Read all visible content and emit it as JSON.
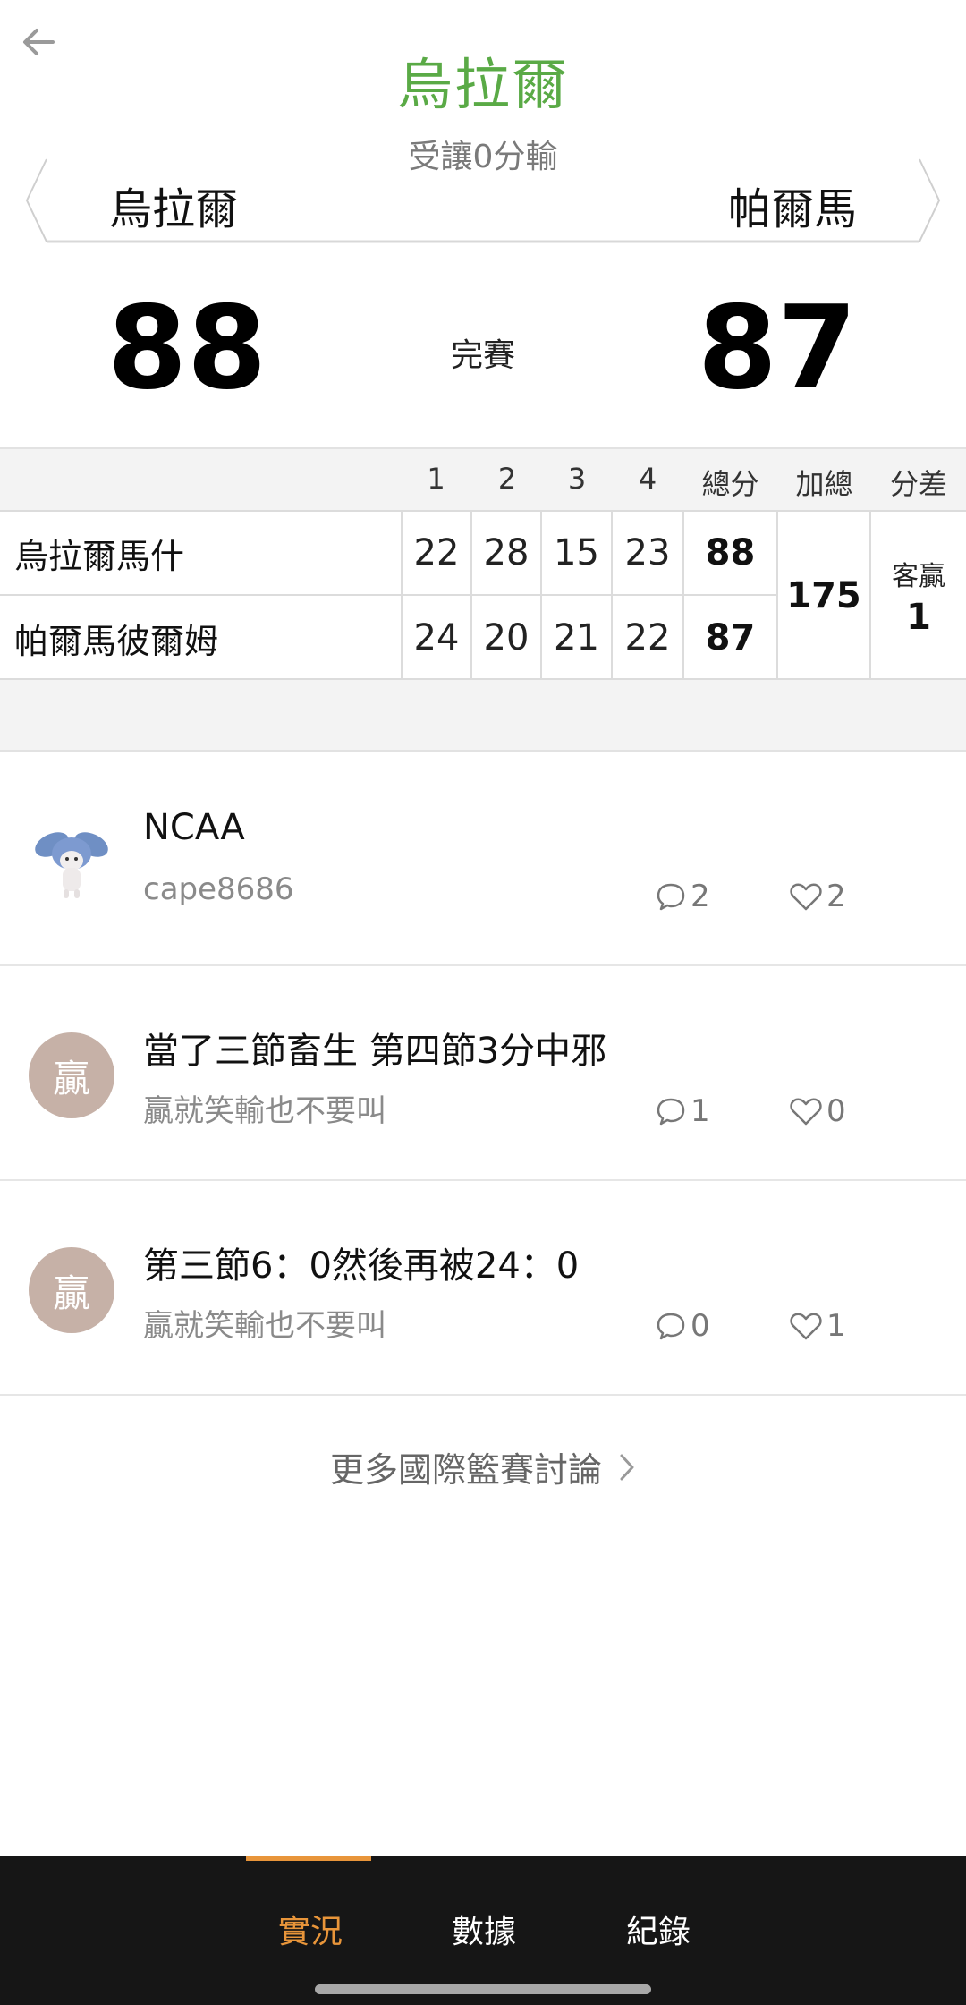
{
  "header": {
    "title": "烏拉爾",
    "handicap": "受讓0分輸",
    "home_team": "烏拉爾",
    "away_team": "帕爾馬",
    "home_score": "88",
    "away_score": "87",
    "status": "完賽"
  },
  "score_table": {
    "headers": [
      "1",
      "2",
      "3",
      "4",
      "總分",
      "加總",
      "分差"
    ],
    "rows": [
      {
        "team": "烏拉爾馬什",
        "q1": "22",
        "q2": "28",
        "q3": "15",
        "q4": "23",
        "total": "88"
      },
      {
        "team": "帕爾馬彼爾姆",
        "q1": "24",
        "q2": "20",
        "q3": "21",
        "q4": "22",
        "total": "87"
      }
    ],
    "combined_total": "175",
    "spread_label": "客贏",
    "spread_value": "1"
  },
  "posts": [
    {
      "title": "NCAA",
      "author": "cape8686",
      "avatar_type": "image",
      "avatar_text": "",
      "comments": "2",
      "likes": "2"
    },
    {
      "title": "當了三節畜生 第四節3分中邪",
      "author": "贏就笑輸也不要叫",
      "avatar_type": "text",
      "avatar_text": "贏",
      "comments": "1",
      "likes": "0"
    },
    {
      "title": "第三節6：0然後再被24：0",
      "author": "贏就笑輸也不要叫",
      "avatar_type": "text",
      "avatar_text": "贏",
      "comments": "0",
      "likes": "1"
    }
  ],
  "more_link": "更多國際籃賽討論",
  "bottom_nav": {
    "items": [
      {
        "label": "實況",
        "active": true
      },
      {
        "label": "數據",
        "active": false
      },
      {
        "label": "紀錄",
        "active": false
      }
    ]
  },
  "colors": {
    "title_green": "#5aaa46",
    "accent_orange": "#e8953a",
    "avatar_bg": "#c6b1a7",
    "nav_bg": "#161616"
  },
  "icons": [
    "back-arrow-icon",
    "comment-icon",
    "heart-icon",
    "chevron-right-icon"
  ]
}
